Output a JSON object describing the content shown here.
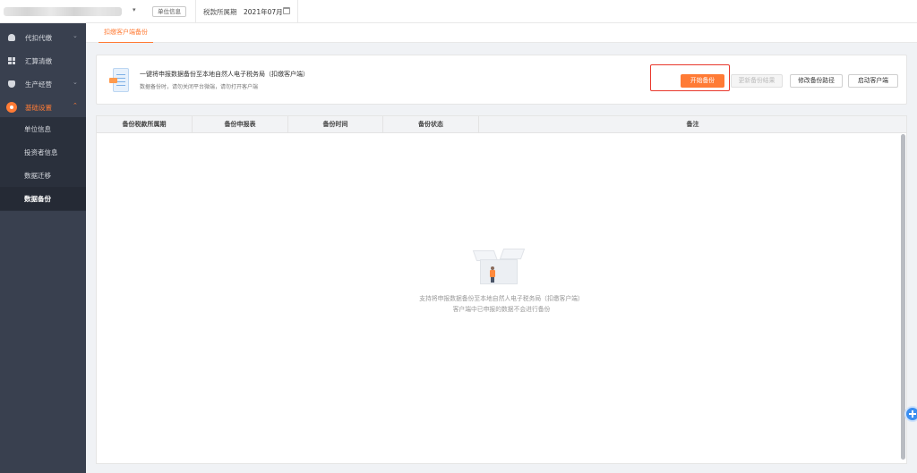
{
  "header": {
    "unit_info_button": "单位信息",
    "period_label": "税款所属期",
    "period_value": "2021年07月"
  },
  "sidebar": {
    "items": [
      {
        "label": "代扣代缴",
        "icon": "user-icon"
      },
      {
        "label": "汇算清缴",
        "icon": "grid-icon"
      },
      {
        "label": "生产经营",
        "icon": "bag-icon"
      },
      {
        "label": "基础设置",
        "icon": "gear-icon"
      }
    ],
    "submenu": [
      "单位信息",
      "投资者信息",
      "数据迁移",
      "数据备份"
    ],
    "selected_submenu": "数据备份",
    "active_color": "#ff7b35"
  },
  "tabs": [
    {
      "label": "扣缴客户端备份"
    }
  ],
  "card": {
    "title": "一键将申报数据备份至本地自然人电子税务局（扣缴客户端）",
    "subtitle": "数据备份时，请勿关闭平台微端，请勿打开客户端",
    "buttons": {
      "start": "开始备份",
      "update_result": "更新备份结果",
      "modify_path": "修改备份路径",
      "launch_client": "启动客户端"
    }
  },
  "table": {
    "columns": [
      "备份税款所属期",
      "备份申报表",
      "备份时间",
      "备份状态",
      "备注"
    ],
    "empty_line_1": "支持将申报数据备份至本地自然人电子税务局（扣缴客户端）",
    "empty_line_2": "客户端中已申报的数据不会进行备份"
  },
  "colors": {
    "accent": "#ff7b35",
    "sidebar_bg": "#39404f",
    "highlight": "#e8382c"
  }
}
